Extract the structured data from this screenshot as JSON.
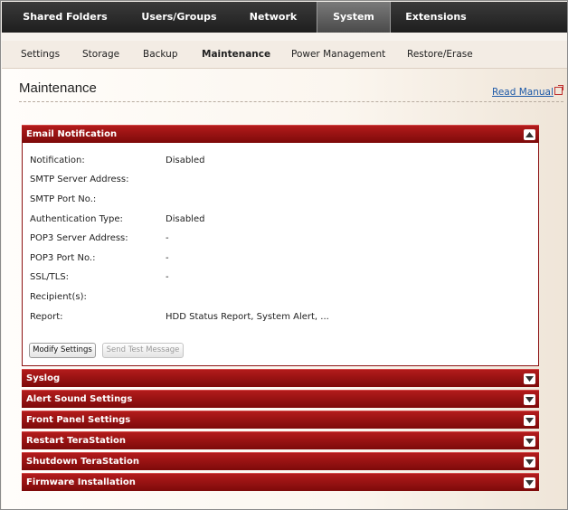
{
  "topnav": {
    "tabs": [
      {
        "label": "Shared Folders"
      },
      {
        "label": "Users/Groups"
      },
      {
        "label": "Network"
      },
      {
        "label": "System"
      },
      {
        "label": "Extensions"
      }
    ],
    "active": "System"
  },
  "subnav": {
    "items": [
      {
        "label": "Settings"
      },
      {
        "label": "Storage"
      },
      {
        "label": "Backup"
      },
      {
        "label": "Maintenance"
      },
      {
        "label": "Power Management"
      },
      {
        "label": "Restore/Erase"
      }
    ],
    "active": "Maintenance"
  },
  "page": {
    "title": "Maintenance",
    "read_manual": "Read Manual"
  },
  "email_panel": {
    "title": "Email Notification",
    "rows": [
      {
        "label": "Notification:",
        "value": "Disabled"
      },
      {
        "label": "SMTP Server Address:",
        "value": ""
      },
      {
        "label": "SMTP Port No.:",
        "value": ""
      },
      {
        "label": "Authentication Type:",
        "value": "Disabled"
      },
      {
        "label": "POP3 Server Address:",
        "value": "-"
      },
      {
        "label": "POP3 Port No.:",
        "value": "-"
      },
      {
        "label": "SSL/TLS:",
        "value": "-"
      },
      {
        "label": "Recipient(s):",
        "value": ""
      },
      {
        "label": "Report:",
        "value": "HDD Status Report, System Alert, ..."
      }
    ],
    "modify_button": "Modify Settings",
    "test_button": "Send Test Message"
  },
  "collapsed_panels": [
    {
      "title": "Syslog"
    },
    {
      "title": "Alert Sound Settings"
    },
    {
      "title": "Front Panel Settings"
    },
    {
      "title": "Restart TeraStation"
    },
    {
      "title": "Shutdown TeraStation"
    },
    {
      "title": "Firmware Installation"
    }
  ],
  "colors": {
    "panel_header": "#9c1414",
    "topnav_bg": "#2a2a2a",
    "link": "#1e5aa8"
  }
}
